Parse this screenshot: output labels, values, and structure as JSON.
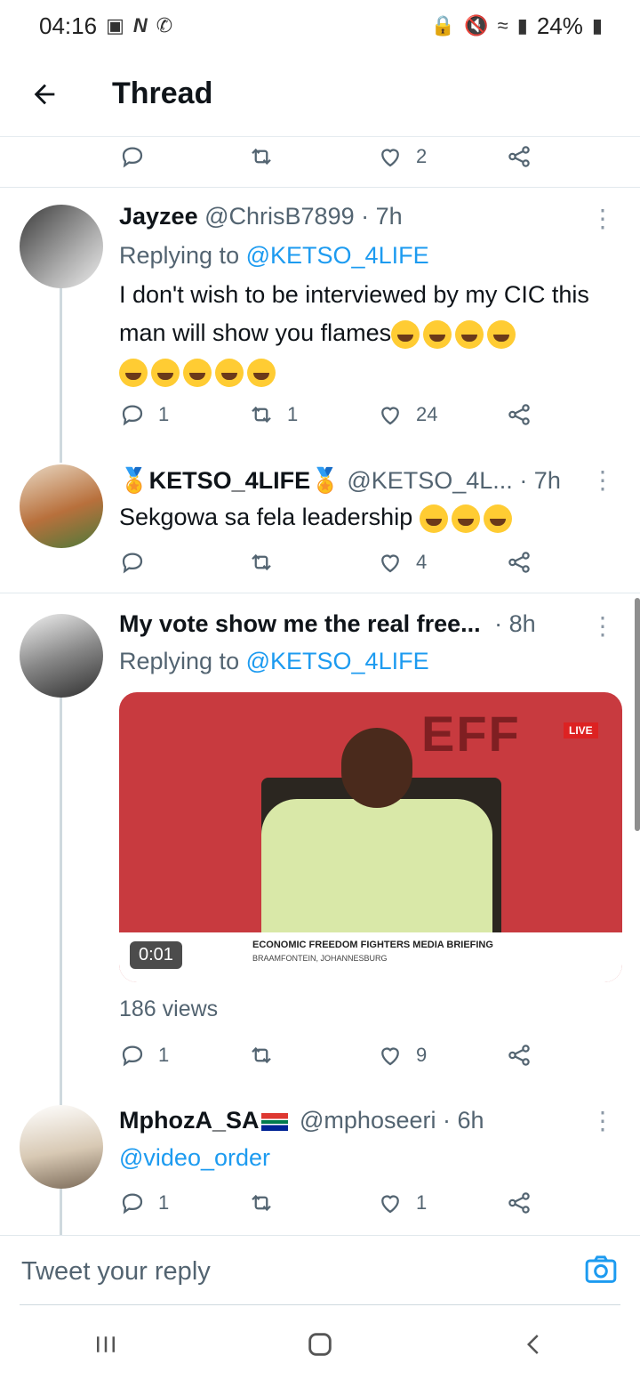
{
  "status_bar": {
    "time": "04:16",
    "battery": "24%"
  },
  "header": {
    "title": "Thread"
  },
  "top_actions": {
    "like_count": "2"
  },
  "tweets": [
    {
      "name": "Jayzee",
      "handle": "@ChrisB7899",
      "time": "· 7h",
      "replying_prefix": "Replying to",
      "replying_to": "@KETSO_4LIFE",
      "text": "I don't wish to be interviewed by my CIC this man will show you flames",
      "reply_count": "1",
      "retweet_count": "1",
      "like_count": "24"
    },
    {
      "name": "KETSO_4LIFE",
      "handle": "@KETSO_4L...",
      "time": "· 7h",
      "text": "Sekgowa sa fela leadership",
      "reply_count": "",
      "retweet_count": "",
      "like_count": "4"
    },
    {
      "name": "My vote show me the real free...",
      "time": "· 8h",
      "replying_prefix": "Replying to",
      "replying_to": "@KETSO_4LIFE",
      "video": {
        "duration": "0:01",
        "live": "LIVE",
        "banner_title": "ECONOMIC FREEDOM FIGHTERS MEDIA BRIEFING",
        "banner_sub": "BRAAMFONTEIN, JOHANNESBURG",
        "logo": "EFF"
      },
      "views": "186 views",
      "reply_count": "1",
      "retweet_count": "",
      "like_count": "9"
    },
    {
      "name": "MphozA_SA",
      "handle": "@mphoseeri",
      "time": "· 6h",
      "text": "@video_order",
      "reply_count": "1",
      "retweet_count": "",
      "like_count": "1"
    }
  ],
  "reply_box": {
    "placeholder": "Tweet your reply"
  },
  "colors": {
    "accent": "#1d9bf0",
    "muted": "#536471",
    "text": "#0f1419"
  }
}
